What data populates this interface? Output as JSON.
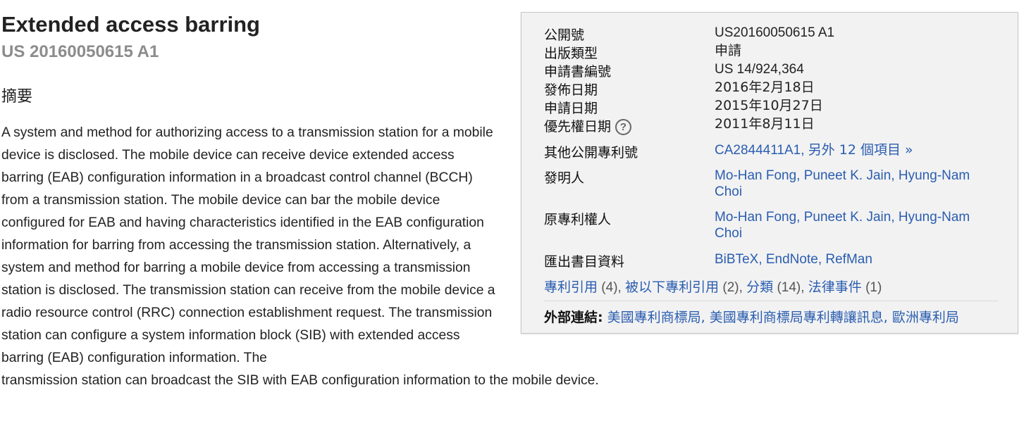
{
  "title": "Extended access barring",
  "publication_number": "US 20160050615 A1",
  "abstract_heading": "摘要",
  "abstract_text": "A system and method for authorizing access to a transmission station for a mobile device is disclosed. The mobile device can receive device extended access barring (EAB) configuration information in a broadcast control channel (BCCH) from a transmission station. The mobile device can bar the mobile device configured for EAB and having characteristics identified in the EAB configuration information for barring from accessing the transmission station. Alternatively, a system and method for barring a mobile device from accessing a transmission station is disclosed. The transmission station can receive from the mobile device a radio resource control (RRC) connection establishment request. The transmission station can configure a system information block (SIB) with extended access barring (EAB) configuration information. The",
  "abstract_tail": "transmission station can broadcast the SIB with EAB configuration information to the mobile device.",
  "info": {
    "pub_no_label": "公開號",
    "pub_no": "US20160050615 A1",
    "pub_type_label": "出版類型",
    "pub_type": "申請",
    "app_no_label": "申請書編號",
    "app_no": "US 14/924,364",
    "pub_date_label": "發佈日期",
    "pub_date": "2016年2月18日",
    "filing_date_label": "申請日期",
    "filing_date": "2015年10月27日",
    "priority_date_label": "優先權日期",
    "priority_help": "?",
    "priority_date": "2011年8月11日",
    "other_pubs_label": "其他公開專利號",
    "other_pub_link": "CA2844411A1",
    "other_pub_more": "另外 12 個項目 »",
    "inventors_label": "發明人",
    "inventor_1": "Mo-Han Fong",
    "inventor_2": "Puneet K. Jain",
    "inventor_3": "Hyung-Nam Choi",
    "assignees_label": "原專利權人",
    "assignee_1": "Mo-Han Fong",
    "assignee_2": "Puneet K. Jain",
    "assignee_3": "Hyung-Nam Choi",
    "export_label": "匯出書目資料",
    "export_bibtex": "BiBTeX",
    "export_endnote": "EndNote",
    "export_refman": "RefMan",
    "citations_link": "專利引用",
    "citations_count": " (4), ",
    "cited_by_link": "被以下專利引用",
    "cited_by_count": " (2), ",
    "classifications_link": "分類",
    "classifications_count": " (14), ",
    "legal_events_link": "法律事件",
    "legal_events_count": " (1)",
    "external_links_label": "外部連結:",
    "external_link_1": "美國專利商標局",
    "external_link_2": "美國專利商標局專利轉讓訊息",
    "external_link_3": "歐洲專利局"
  },
  "colors": {
    "link": "#2a5db0",
    "box_bg": "#f2f2f2",
    "subtitle": "#8c8c8c"
  }
}
